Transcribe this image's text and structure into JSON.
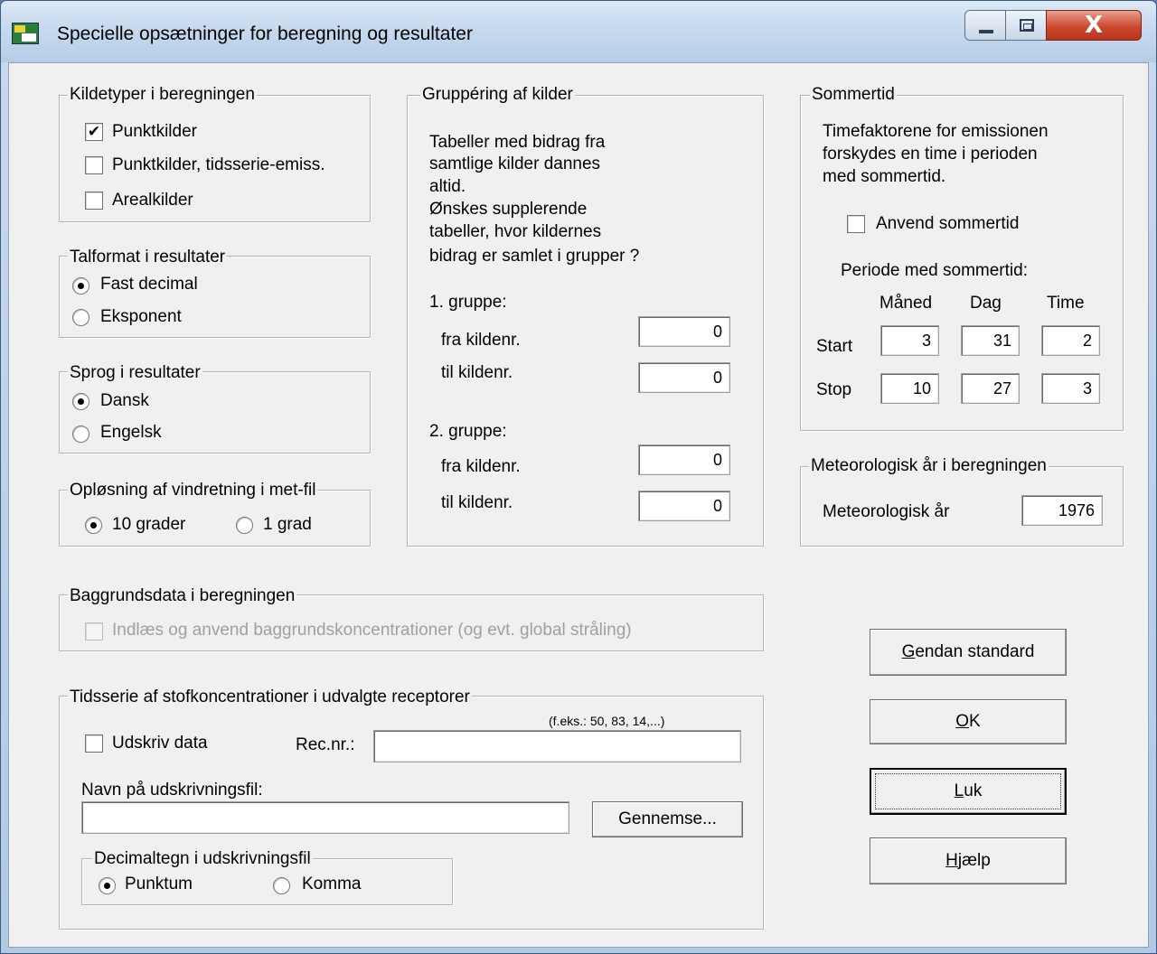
{
  "window": {
    "title": "Specielle opsætninger for beregning og resultater",
    "close_glyph": "X"
  },
  "kildetyper": {
    "legend": "Kildetyper i beregningen",
    "items": [
      {
        "label": "Punktkilder",
        "checked": true,
        "mark": "✔"
      },
      {
        "label": "Punktkilder, tidsserie-emiss.",
        "checked": false
      },
      {
        "label": "Arealkilder",
        "checked": false
      }
    ]
  },
  "talformat": {
    "legend": "Talformat i resultater",
    "options": [
      "Fast decimal",
      "Eksponent"
    ],
    "selected": "Fast decimal"
  },
  "sprog": {
    "legend": "Sprog i resultater",
    "options": [
      "Dansk",
      "Engelsk"
    ],
    "selected": "Dansk"
  },
  "oploesning": {
    "legend": "Opløsning af vindretning i met-fil",
    "options": [
      "10 grader",
      "1 grad"
    ],
    "selected": "10 grader"
  },
  "gruppering": {
    "legend": "Gruppéring af kilder",
    "description": [
      "Tabeller med bidrag fra",
      "samtlige kilder dannes",
      "altid.",
      "Ønskes supplerende",
      "tabeller, hvor kildernes",
      "bidrag er samlet i grupper ?"
    ],
    "group1": {
      "label": "1. gruppe:",
      "fra_label": "fra kildenr.",
      "fra_value": "0",
      "til_label": "til kildenr.",
      "til_value": "0"
    },
    "group2": {
      "label": "2. gruppe:",
      "fra_label": "fra kildenr.",
      "fra_value": "0",
      "til_label": "til kildenr.",
      "til_value": "0"
    }
  },
  "sommertid": {
    "legend": "Sommertid",
    "description": [
      "Timefaktorene for emissionen",
      "forskydes en time i perioden",
      "med sommertid."
    ],
    "checkbox_label": "Anvend sommertid",
    "checked": false,
    "periode_label": "Periode med sommertid:",
    "headers": [
      "Måned",
      "Dag",
      "Time"
    ],
    "start": {
      "label": "Start",
      "values": [
        "3",
        "31",
        "2"
      ]
    },
    "stop": {
      "label": "Stop",
      "values": [
        "10",
        "27",
        "3"
      ]
    }
  },
  "meteorologisk": {
    "legend": "Meteorologisk år i beregningen",
    "label": "Meteorologisk år",
    "value": "1976"
  },
  "baggrund": {
    "legend": "Baggrundsdata i beregningen",
    "checkbox_label": "Indlæs og anvend baggrundskoncentrationer (og evt. global stråling)",
    "checked": false,
    "disabled": true
  },
  "tidsserie": {
    "legend": "Tidsserie af stofkoncentrationer i udvalgte receptorer",
    "hint": "(f.eks.:  50, 83, 14,...)",
    "udskriv_label": "Udskriv data",
    "udskriv_checked": false,
    "recnr_label": "Rec.nr.:",
    "recnr_value": "",
    "filnavn_label": "Navn på udskrivningsfil:",
    "filnavn_value": "",
    "browse_label": "Gennemse...",
    "decimal": {
      "legend": "Decimaltegn i udskrivningsfil",
      "options": [
        "Punktum",
        "Komma"
      ],
      "selected": "Punktum"
    }
  },
  "buttons": {
    "gendan": {
      "accel": "G",
      "rest": "endan standard"
    },
    "ok": {
      "accel": "O",
      "rest": "K"
    },
    "luk": {
      "accel": "L",
      "rest": "uk"
    },
    "hjaelp": {
      "accel": "H",
      "rest": "jælp"
    }
  }
}
